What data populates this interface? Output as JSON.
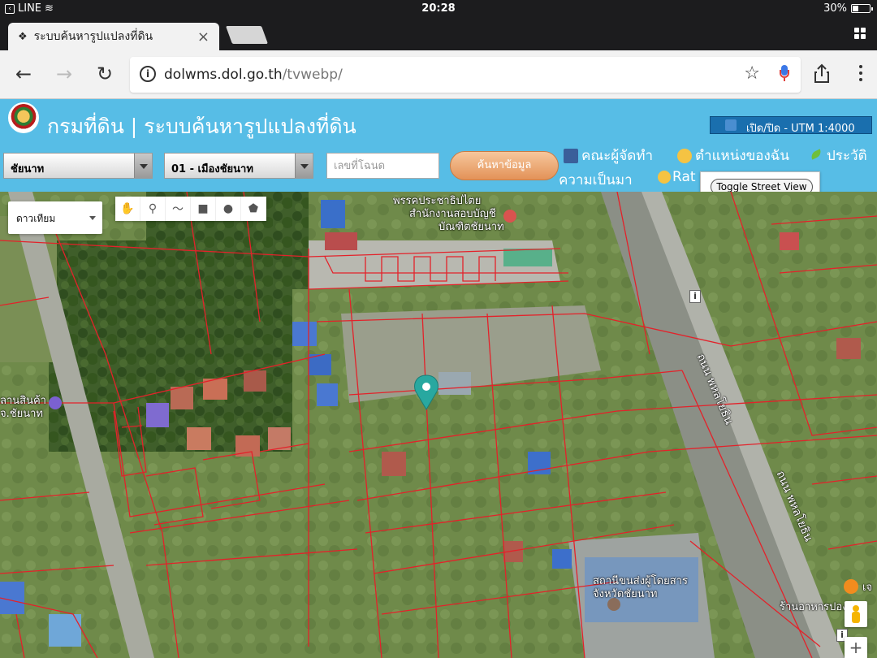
{
  "statusbar": {
    "carrier": "LINE",
    "time": "20:28",
    "battery": "30%",
    "battery_level": 0.3
  },
  "browser": {
    "tab_title": "ระบบค้นหารูปแปลงที่ดิน",
    "url_host": "dolwms.dol.go.th",
    "url_path": "/tvwebp/"
  },
  "header": {
    "title": "กรมที่ดิน | ระบบค้นหารูปแปลงที่ดิน",
    "layer_toggle": "เปิด/ปิด - UTM 1:4000",
    "province": "ชัยนาท",
    "district": "01 - เมืองชัยนาท",
    "deed_placeholder": "เลขที่โฉนด",
    "search_button": "ค้นหาข้อมูล",
    "menu": {
      "team": "คณะผู้จัดทำ",
      "my_location": "ตำแหน่งของฉัน",
      "history_prefix": "ประวัติ",
      "background": "ความเป็นมา",
      "rate": "Rat"
    },
    "street_view_button": "Toggle Street View"
  },
  "map": {
    "map_type": "ดาวเทียม",
    "labels": {
      "party": "พรรคประชาธิปไตย",
      "office": "สำนักงานสอบบัญชี",
      "office2": "บัณฑิตชัยนาท",
      "store": "ลานสินค้า",
      "store2": "จ.ชัยนาท",
      "road1": "ถนน พหลโยธิน",
      "road2": "ถนน พหลโยธิน",
      "bus": "สถานีขนส่งผู้โดยสาร",
      "bus2": "จังหวัดชัยนาท",
      "restaurant": "ร้านอาหารปอง",
      "restaurant_prefix": "เจ"
    }
  }
}
